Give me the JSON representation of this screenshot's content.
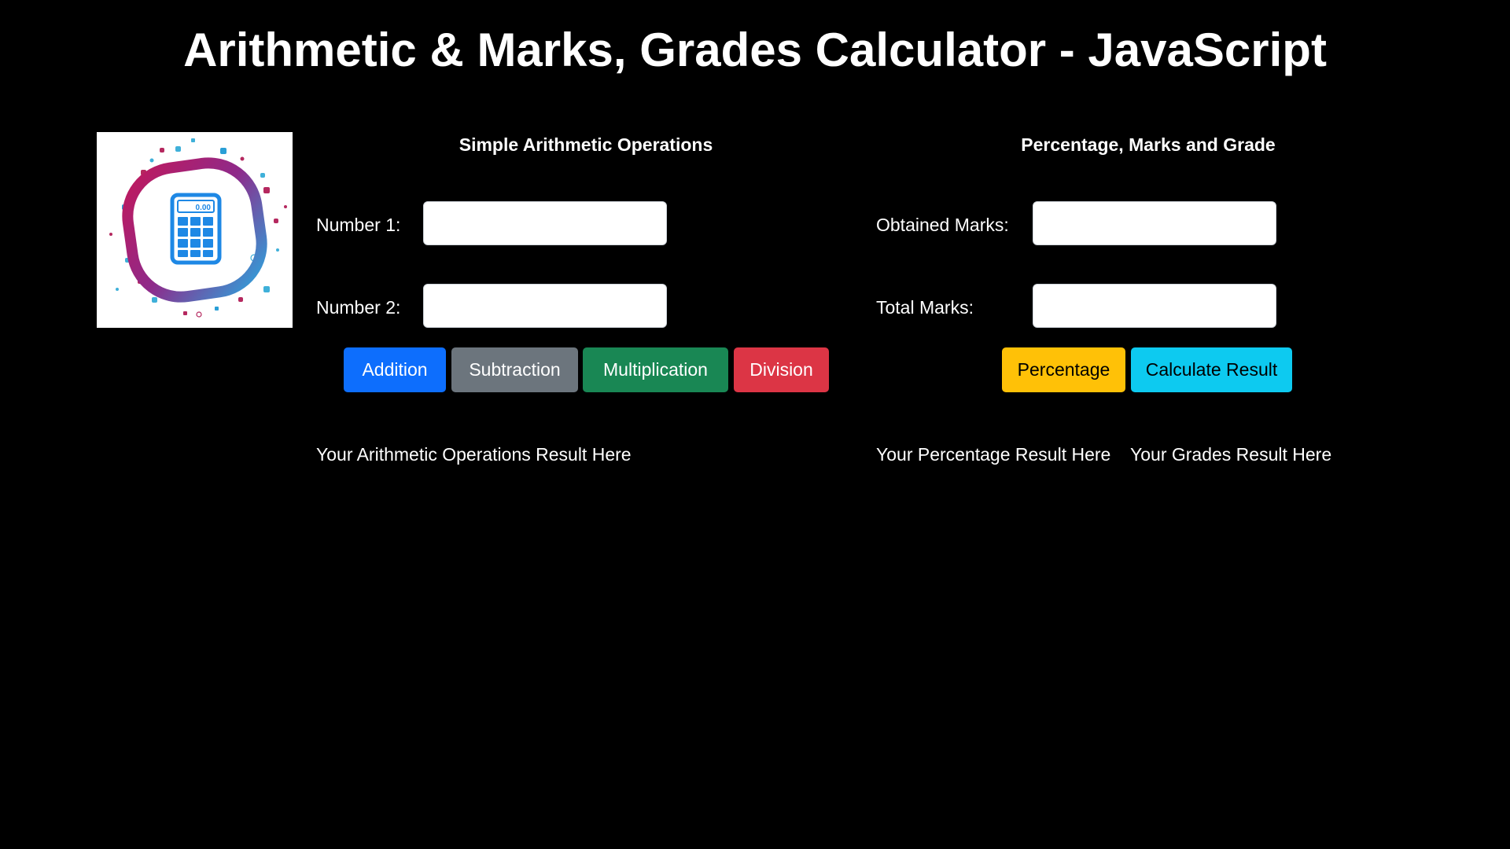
{
  "page": {
    "title": "Arithmetic & Marks, Grades Calculator - JavaScript"
  },
  "logo": {
    "icon": "calculator-icon",
    "display_text": "0.00"
  },
  "arithmetic": {
    "heading": "Simple Arithmetic Operations",
    "number1_label": "Number 1:",
    "number1_value": "",
    "number2_label": "Number 2:",
    "number2_value": "",
    "buttons": {
      "addition": "Addition",
      "subtraction": "Subtraction",
      "multiplication": "Multiplication",
      "division": "Division"
    },
    "result": "Your Arithmetic Operations Result Here"
  },
  "grades": {
    "heading": "Percentage, Marks and Grade",
    "obtained_label": "Obtained Marks:",
    "obtained_value": "",
    "total_label": "Total Marks:",
    "total_value": "",
    "buttons": {
      "percentage": "Percentage",
      "calculate": "Calculate Result"
    },
    "percentage_result": "Your Percentage Result Here",
    "grade_result": "Your Grades Result Here"
  },
  "colors": {
    "background": "#000000",
    "primary": "#0d6efd",
    "secondary": "#6c757d",
    "success": "#198754",
    "danger": "#dc3545",
    "warning": "#ffc107",
    "info": "#0dcaf0"
  }
}
